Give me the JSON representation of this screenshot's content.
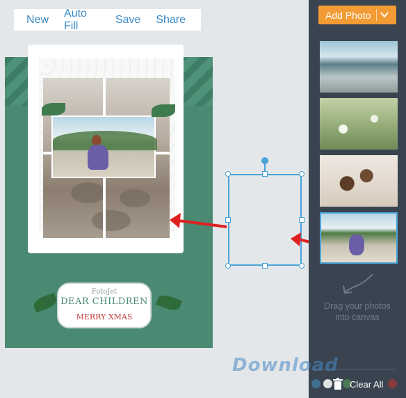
{
  "toolbar": {
    "items": [
      "New",
      "Auto Fill",
      "Save",
      "Share"
    ]
  },
  "card": {
    "brand": "FotoJet",
    "title": "DEAR CHILDREN",
    "subtitle": "MERRY XMAS"
  },
  "sidebar": {
    "add_photo_label": "Add Photo",
    "drag_hint": "Drag your photos into canvas",
    "clear_all_label": "Clear All"
  },
  "watermark": "Download",
  "colors": {
    "accent": "#f39b34",
    "selection": "#4aa3d9",
    "sidebar_bg": "#3a4450",
    "canvas_bg": "#4a8a72",
    "arrow": "#e02020"
  },
  "icons": [
    "chevron-down-icon",
    "trash-icon",
    "drag-arrow-icon",
    "rotate-handle-icon"
  ]
}
